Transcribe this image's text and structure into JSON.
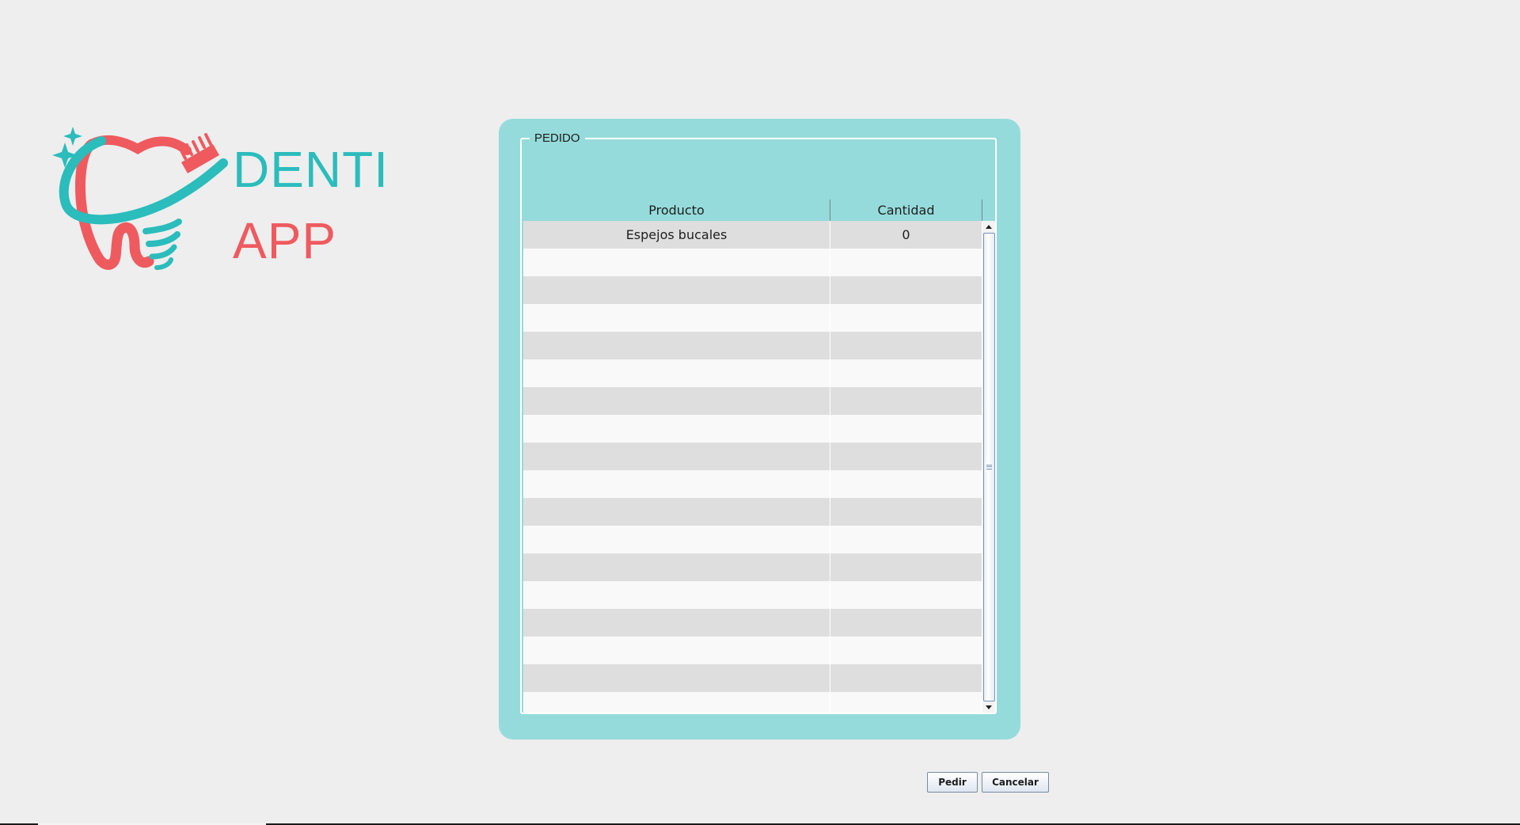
{
  "logo": {
    "line1": "DENTI",
    "line2": "APP",
    "icon": "tooth-toothbrush-logo-icon",
    "teal": "#2bbcbc",
    "coral": "#ef5a5f"
  },
  "panel": {
    "background": "#96dbdb",
    "title": "PEDIDO"
  },
  "table": {
    "columns": [
      "Producto",
      "Cantidad"
    ],
    "rows": [
      [
        "Espejos bucales",
        "0"
      ],
      [
        "",
        ""
      ],
      [
        "",
        ""
      ],
      [
        "",
        ""
      ],
      [
        "",
        ""
      ],
      [
        "",
        ""
      ],
      [
        "",
        ""
      ],
      [
        "",
        ""
      ],
      [
        "",
        ""
      ],
      [
        "",
        ""
      ],
      [
        "",
        ""
      ],
      [
        "",
        ""
      ],
      [
        "",
        ""
      ],
      [
        "",
        ""
      ],
      [
        "",
        ""
      ],
      [
        "",
        ""
      ],
      [
        "",
        ""
      ],
      [
        "",
        ""
      ]
    ],
    "scroll_up_icon": "scroll-up-arrow-icon",
    "scroll_down_icon": "scroll-down-arrow-icon"
  },
  "actions": {
    "order_label": "Pedir",
    "cancel_label": "Cancelar"
  }
}
